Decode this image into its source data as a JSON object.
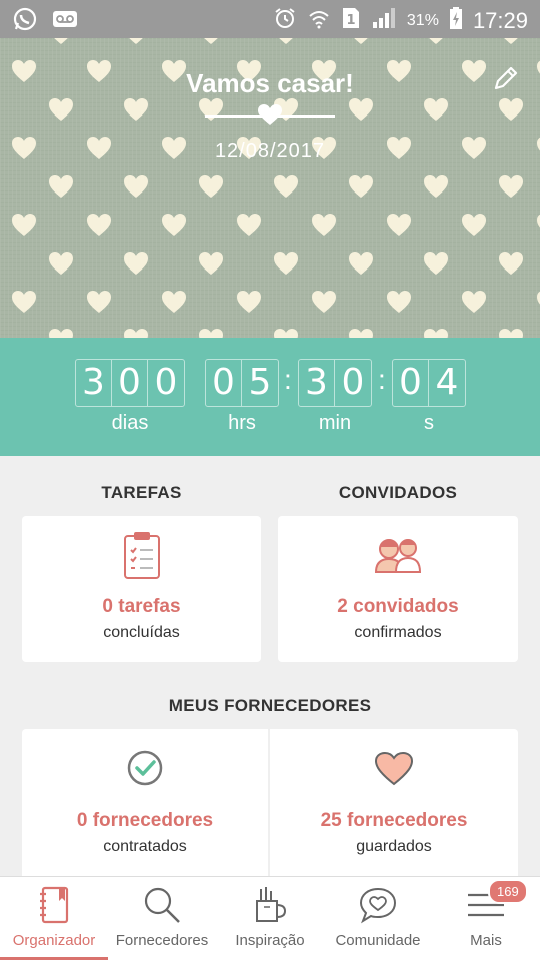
{
  "status_bar": {
    "time": "17:29",
    "battery_pct": "31%",
    "icons": [
      "whatsapp-icon",
      "voicemail-icon",
      "alarm-icon",
      "wifi-icon",
      "sim-icon",
      "signal-icon",
      "battery-charging-icon"
    ]
  },
  "header": {
    "title": "Vamos casar!",
    "date": "12/08/2017",
    "edit_icon": "pencil-icon"
  },
  "countdown": {
    "days": [
      "3",
      "0",
      "0"
    ],
    "hours": [
      "0",
      "5"
    ],
    "minutes": [
      "3",
      "0"
    ],
    "seconds": [
      "0",
      "4"
    ],
    "labels": {
      "days": "dias",
      "hours": "hrs",
      "minutes": "min",
      "seconds": "s"
    }
  },
  "sections": {
    "tasks": {
      "title": "TAREFAS",
      "count": "0 tarefas",
      "sub": "concluídas",
      "icon": "clipboard-icon"
    },
    "guests": {
      "title": "CONVIDADOS",
      "count": "2 convidados",
      "sub": "confirmados",
      "icon": "couple-icon"
    },
    "vendors": {
      "title": "MEUS FORNECEDORES",
      "hired": {
        "count": "0 fornecedores",
        "sub": "contratados",
        "icon": "check-circle-icon"
      },
      "saved": {
        "count": "25 fornecedores",
        "sub": "guardados",
        "icon": "heart-icon"
      }
    }
  },
  "bottom_nav": {
    "items": [
      {
        "label": "Organizador",
        "icon": "notebook-icon",
        "active": true
      },
      {
        "label": "Fornecedores",
        "icon": "search-icon"
      },
      {
        "label": "Inspiração",
        "icon": "inspiration-icon"
      },
      {
        "label": "Comunidade",
        "icon": "chat-heart-icon"
      },
      {
        "label": "Mais",
        "icon": "menu-icon",
        "badge": "169"
      }
    ]
  },
  "colors": {
    "accent": "#d9726d",
    "teal": "#6cc3b0",
    "status_bar": "#9a9a9a"
  }
}
